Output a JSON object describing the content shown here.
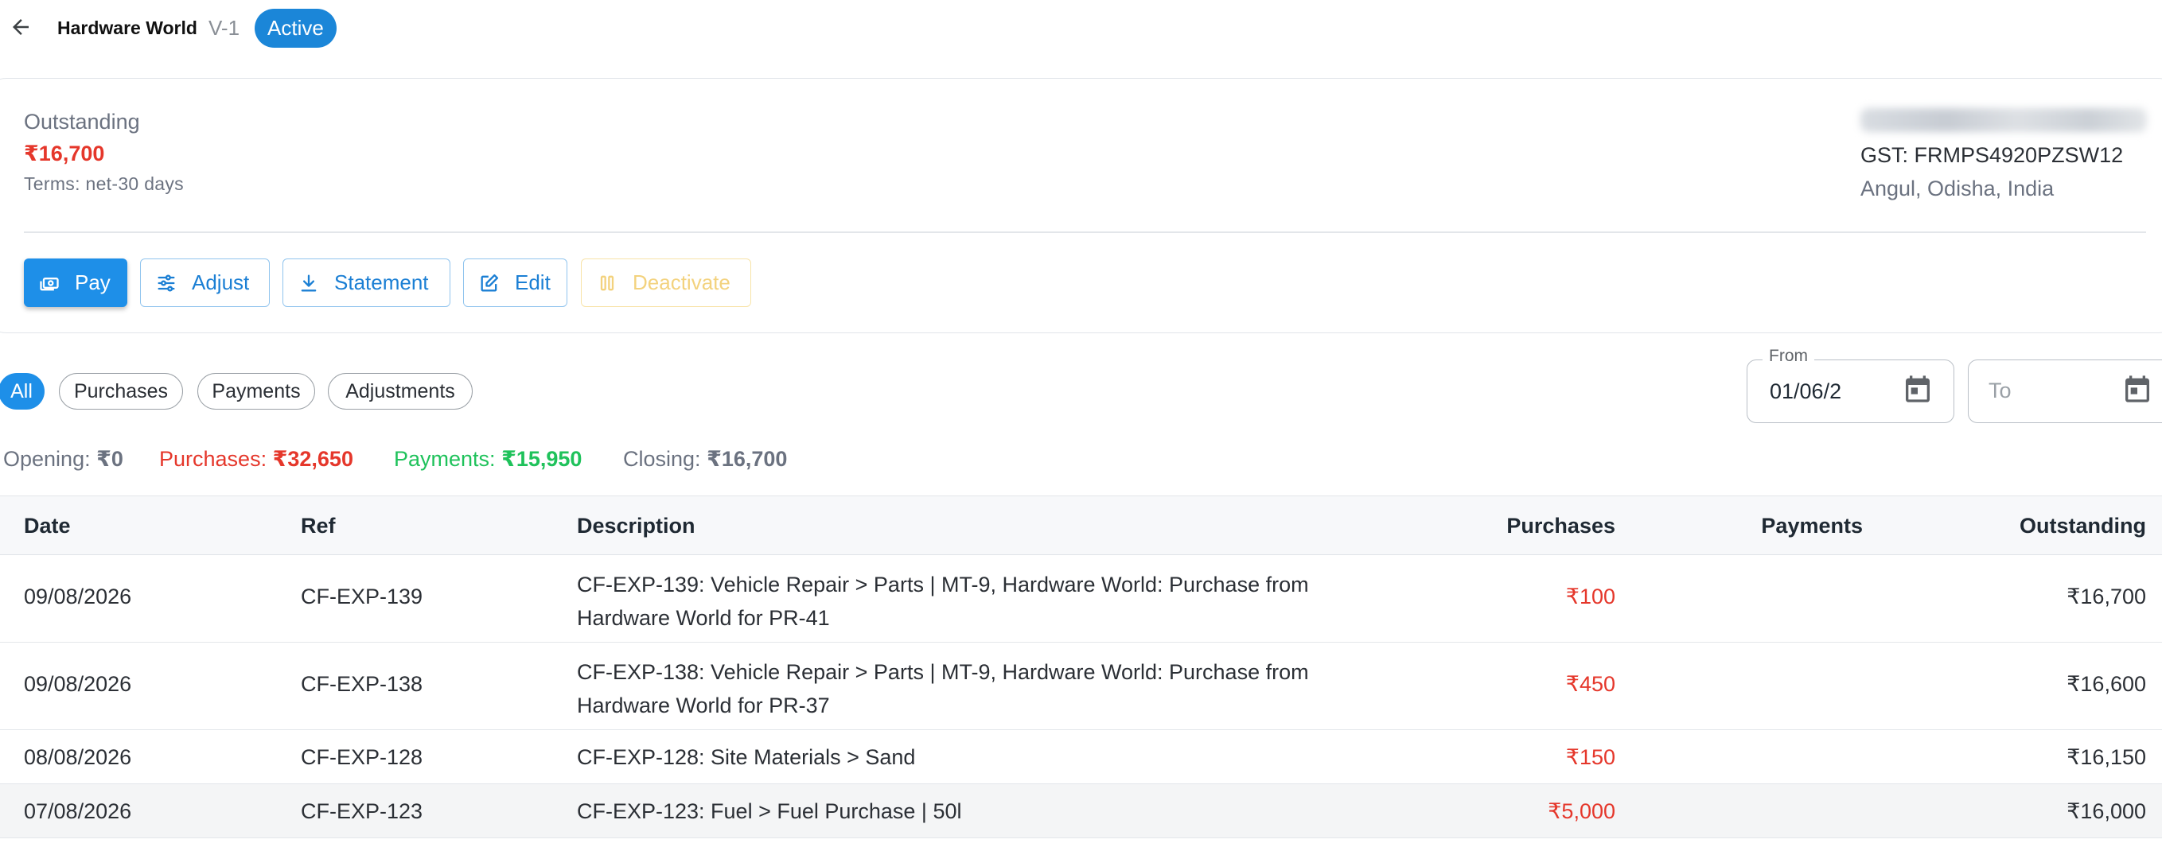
{
  "header": {
    "vendor_name": "Hardware World",
    "vendor_code": "V-1",
    "status": "Active"
  },
  "summary": {
    "outstanding_label": "Outstanding",
    "outstanding_value": "₹16,700",
    "terms": "Terms: net-30 days",
    "gst": "GST: FRMPS4920PZSW12",
    "location": "Angul, Odisha, India"
  },
  "actions": {
    "pay": "Pay",
    "adjust": "Adjust",
    "statement": "Statement",
    "edit": "Edit",
    "deactivate": "Deactivate"
  },
  "filters": {
    "all": "All",
    "purchases": "Purchases",
    "payments": "Payments",
    "adjustments": "Adjustments"
  },
  "date_range": {
    "from_label": "From",
    "from_value": "01/06/2",
    "to_placeholder": "To"
  },
  "totals": {
    "opening_label": "Opening:",
    "opening_value": "₹0",
    "purchases_label": "Purchases:",
    "purchases_value": "₹32,650",
    "payments_label": "Payments:",
    "payments_value": "₹15,950",
    "closing_label": "Closing:",
    "closing_value": "₹16,700"
  },
  "table": {
    "columns": [
      "Date",
      "Ref",
      "Description",
      "Purchases",
      "Payments",
      "Outstanding"
    ],
    "rows": [
      {
        "date": "09/08/2026",
        "ref": "CF-EXP-139",
        "description": "CF-EXP-139: Vehicle Repair > Parts | MT-9, Hardware World: Purchase from Hardware World for PR-41",
        "purchases": "₹100",
        "payments": "",
        "outstanding": "₹16,700"
      },
      {
        "date": "09/08/2026",
        "ref": "CF-EXP-138",
        "description": "CF-EXP-138: Vehicle Repair > Parts | MT-9, Hardware World: Purchase from Hardware World for PR-37",
        "purchases": "₹450",
        "payments": "",
        "outstanding": "₹16,600"
      },
      {
        "date": "08/08/2026",
        "ref": "CF-EXP-128",
        "description": "CF-EXP-128: Site Materials > Sand",
        "purchases": "₹150",
        "payments": "",
        "outstanding": "₹16,150"
      },
      {
        "date": "07/08/2026",
        "ref": "CF-EXP-123",
        "description": "CF-EXP-123: Fuel > Fuel Purchase | 50l",
        "purchases": "₹5,000",
        "payments": "",
        "outstanding": "₹16,000"
      }
    ]
  },
  "colors": {
    "primary": "#1e8fe8",
    "negative": "#e5372b",
    "positive": "#1fc25b",
    "warning_muted": "#f3d27e"
  },
  "icons": {
    "back": "arrow-left-icon",
    "pay": "cash-icon",
    "adjust": "sliders-icon",
    "statement": "download-icon",
    "edit": "pencil-icon",
    "deactivate": "pause-icon",
    "calendar": "calendar-icon"
  }
}
